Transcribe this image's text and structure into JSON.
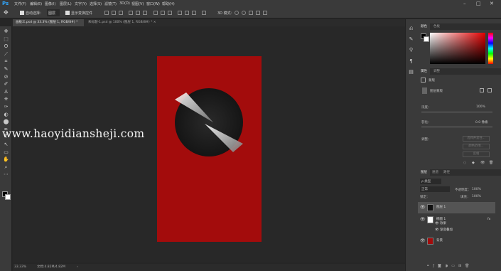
{
  "app": {
    "logo": "Ps"
  },
  "menu": [
    "文件(F)",
    "编辑(E)",
    "图像(I)",
    "图层(L)",
    "文字(Y)",
    "选择(S)",
    "滤镜(T)",
    "3D(D)",
    "视图(V)",
    "窗口(W)",
    "帮助(H)"
  ],
  "window_buttons": {
    "minimize": "–",
    "restore": "□",
    "close": "✕"
  },
  "options": {
    "move_icon": "✥",
    "auto_select_label": "自动选择：",
    "auto_select_value": "图层",
    "show_transform_label": "显示变换控件",
    "mode_3d_label": "3D 模式："
  },
  "tabs": [
    {
      "label": "画板三.psd @ 33.3% (图层 1, RGB/8#) *",
      "close": "×"
    },
    {
      "label": "未标题-1.psd @ 100% (图层 1, RGB/8#) *",
      "close": "×"
    }
  ],
  "tools": [
    "✥",
    "⬚",
    "ʘ",
    "⟋",
    "⌗",
    "✎",
    "⊘",
    "✐",
    "♙",
    "⎈",
    "✑",
    "◐",
    "⬤",
    "✒",
    "T",
    "↖",
    "▭",
    "✋",
    "⌕",
    "⋯"
  ],
  "swatches": {
    "foreground": "#000000",
    "background": "#ffffff"
  },
  "watermark": "www.haoyidiansheji.com",
  "status": {
    "zoom": "33.33%",
    "doc": "文档:4.82M/4.82M",
    "arrow": "›"
  },
  "panels": {
    "color_tabs": [
      "颜色",
      "色板"
    ],
    "properties_tabs": [
      "属性",
      "调整"
    ],
    "properties": {
      "type_label": "蒙版",
      "mask_label": "图层蒙版",
      "density_label": "浓度：",
      "density_value": "100%",
      "feather_label": "羽化：",
      "feather_value": "0.0 像素",
      "refine_label": "调整：",
      "btn_select_mask": "选择并遮住...",
      "btn_color_range": "颜色范围...",
      "btn_invert": "反相"
    },
    "layers_tabs": [
      "图层",
      "通道",
      "路径"
    ],
    "layers_toolbar": {
      "kind": "ρ 类型",
      "blend": "正常",
      "opacity_label": "不透明度：",
      "opacity": "100%",
      "lock_label": "锁定：",
      "fill_label": "填充：",
      "fill": "100%"
    },
    "layers": [
      {
        "name": "图层 1",
        "fx": ""
      },
      {
        "name": "椭圆 1",
        "fx": "fx"
      },
      {
        "name": "效果",
        "fx": ""
      },
      {
        "name": "渐变叠加",
        "fx": ""
      },
      {
        "name": "背景",
        "fx": ""
      }
    ]
  },
  "colors": {
    "canvas_red": "#a30c0c",
    "accent_blue": "#31a8ff",
    "panel": "#3a3a3a"
  }
}
